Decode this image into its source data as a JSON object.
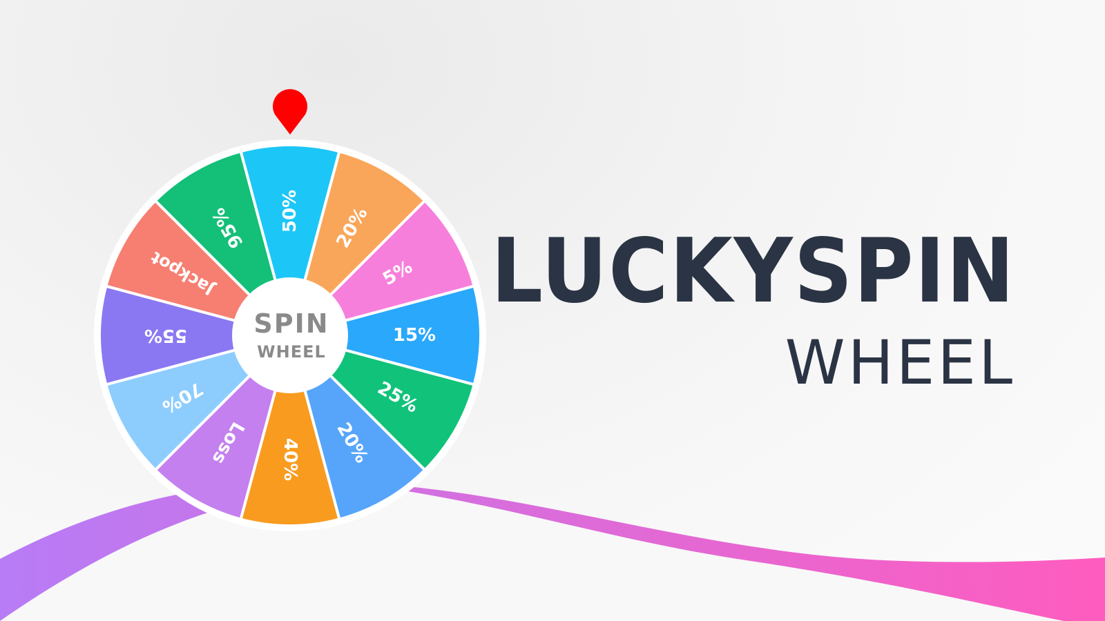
{
  "title": {
    "line1": "LUCKYSPIN",
    "line2": "WHEEL"
  },
  "wheel": {
    "center_line1": "SPIN",
    "center_line2": "WHEEL",
    "pointer_icon": "map-pin-icon",
    "segments": [
      {
        "label": "50%",
        "color": "#1cc6f7"
      },
      {
        "label": "20%",
        "color": "#f9a65a"
      },
      {
        "label": "5%",
        "color": "#f77fdc"
      },
      {
        "label": "15%",
        "color": "#2aa8fb"
      },
      {
        "label": "25%",
        "color": "#11c27a"
      },
      {
        "label": "20%",
        "color": "#56a5fb"
      },
      {
        "label": "40%",
        "color": "#f89b1f"
      },
      {
        "label": "Loss",
        "color": "#c480ee"
      },
      {
        "label": "70%",
        "color": "#8dcdfd"
      },
      {
        "label": "55%",
        "color": "#8a78f2"
      },
      {
        "label": "Jackpot",
        "color": "#f67f72"
      },
      {
        "label": "95%",
        "color": "#14bf78"
      }
    ]
  },
  "colors": {
    "title": "#2b3444",
    "pointer": "#ff0000",
    "wave_start": "#b77cf6",
    "wave_end": "#ff5cbe",
    "center_text": "#8a8a8a"
  }
}
